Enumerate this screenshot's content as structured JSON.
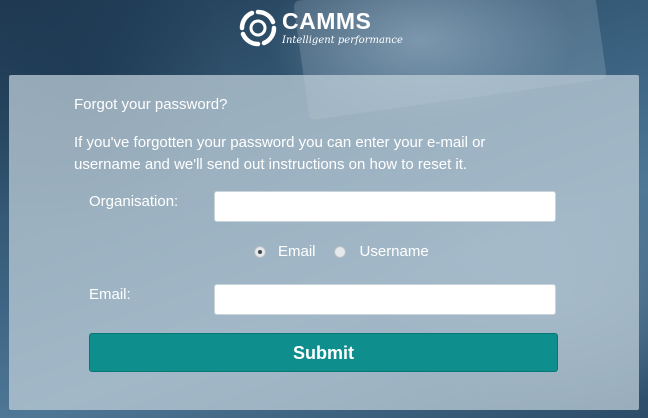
{
  "brand": {
    "name": "CAMMS",
    "tagline": "Intelligent performance",
    "logo_icon": "camms-swirl-logo-icon"
  },
  "form": {
    "heading": "Forgot your password?",
    "instructions": "If you've forgotten your password you can enter your e-mail or username and we'll send out instructions on how to reset it.",
    "organisation_label": "Organisation:",
    "organisation_value": "",
    "lookup_options": [
      {
        "label": "Email",
        "selected": true
      },
      {
        "label": "Username",
        "selected": false
      }
    ],
    "email_label": "Email:",
    "email_value": "",
    "submit_label": "Submit"
  },
  "colors": {
    "submit_button": "#0e8f8d",
    "panel": "#bdcdd8"
  }
}
